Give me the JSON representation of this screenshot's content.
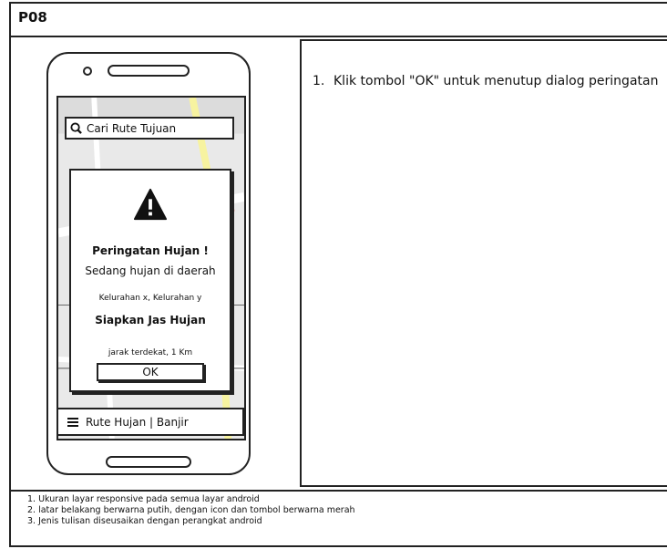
{
  "header": {
    "title": "P08"
  },
  "step": {
    "number": "1.",
    "text": "Klik tombol \"OK\" untuk menutup dialog peringatan"
  },
  "phone": {
    "search": {
      "placeholder": "Cari Rute Tujuan",
      "icon": "search-icon"
    },
    "dialog": {
      "icon": "warning-icon",
      "title": "Peringatan Hujan !",
      "line1": "Sedang hujan di daerah",
      "line2": "Kelurahan x, Kelurahan y",
      "line3": "Siapkan Jas Hujan",
      "line4": "jarak terdekat, 1 Km",
      "ok_label": "OK"
    },
    "bottom_bar": {
      "icon": "menu-icon",
      "label": "Rute Hujan | Banjir"
    }
  },
  "notes": [
    "1. Ukuran layar responsive pada semua layar android",
    "2. latar belakang berwarna putih, dengan icon dan tombol berwarna merah",
    "3. Jenis tulisan diseusaikan dengan perangkat android"
  ]
}
